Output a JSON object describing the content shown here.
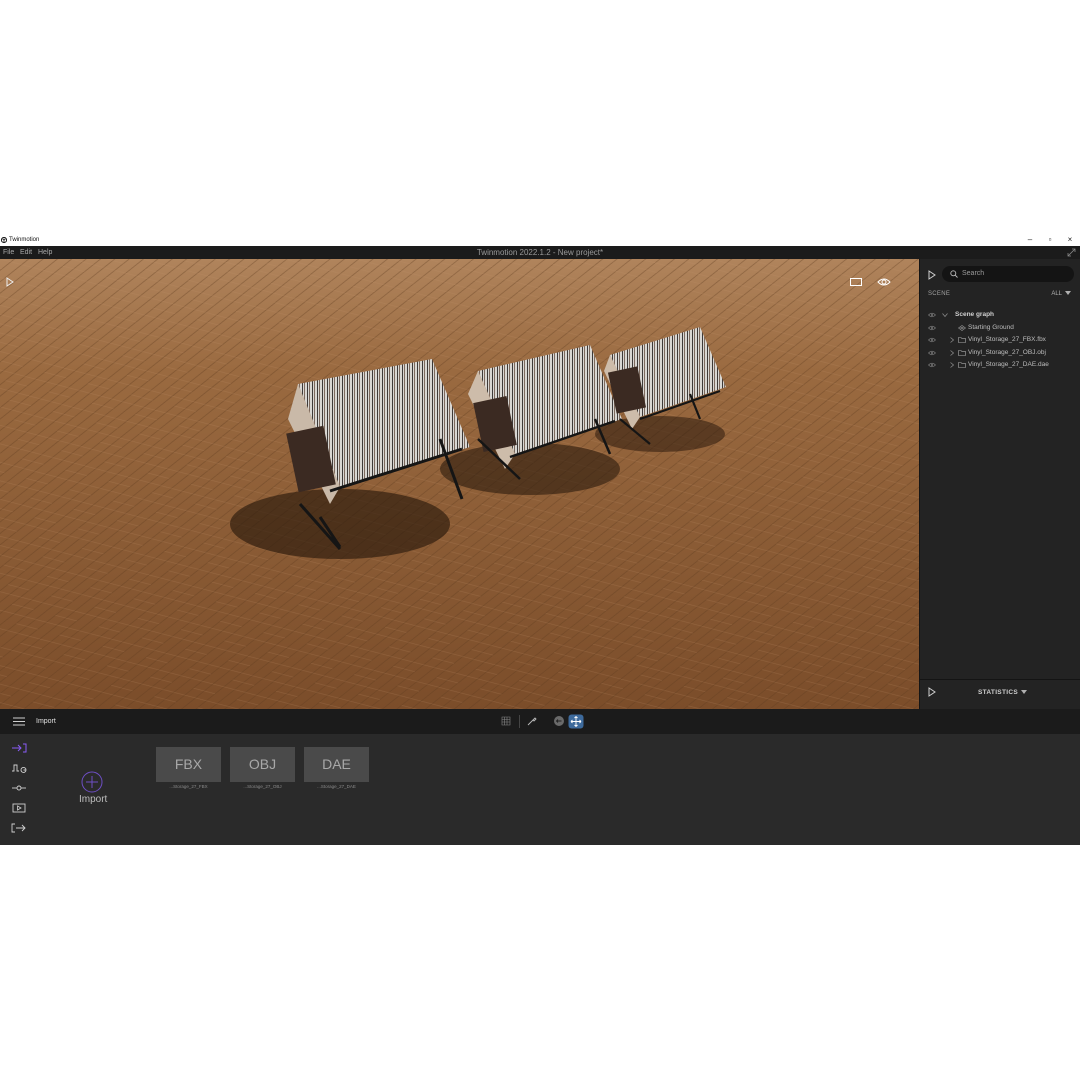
{
  "os_window": {
    "title": "Twinmotion",
    "minimize": "–",
    "restore": "▫",
    "close": "×"
  },
  "menubar": {
    "items": [
      "File",
      "Edit",
      "Help"
    ],
    "app_title": "Twinmotion 2022.1.2 - New project*"
  },
  "scene_panel": {
    "search_placeholder": "Search",
    "section_label": "SCENE",
    "filter_label": "ALL",
    "tree": [
      {
        "label": "Scene graph"
      },
      {
        "label": "Starting Ground"
      },
      {
        "label": "Vinyl_Storage_27_FBX.fbx"
      },
      {
        "label": "Vinyl_Storage_27_OBJ.obj"
      },
      {
        "label": "Vinyl_Storage_27_DAE.dae"
      }
    ],
    "statistics_label": "STATISTICS"
  },
  "toolbar": {
    "title": "Import"
  },
  "import_panel": {
    "import_label": "Import",
    "assets": [
      {
        "type": "FBX",
        "name": "...Storage_27_FBX"
      },
      {
        "type": "OBJ",
        "name": "...Storage_27_OBJ"
      },
      {
        "type": "DAE",
        "name": "...Storage_27_DAE"
      }
    ]
  },
  "colors": {
    "accent_purple": "#8a5cf6",
    "selected_tool_blue": "#3d6a9c",
    "floor_wood": "#8a5a34",
    "panel_bg": "#232323"
  }
}
